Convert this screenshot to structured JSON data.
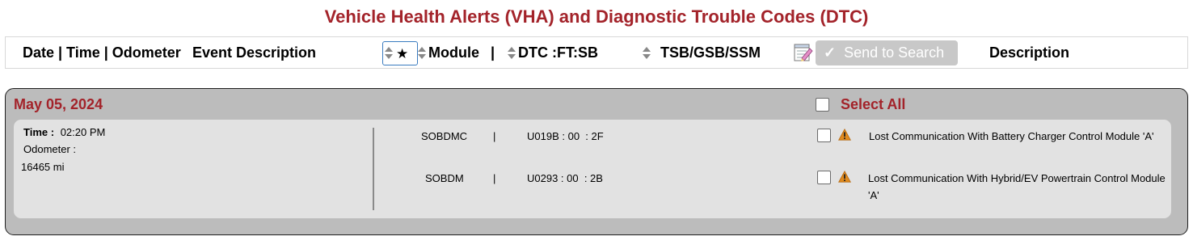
{
  "title": "Vehicle Health Alerts (VHA) and Diagnostic Trouble Codes (DTC)",
  "header": {
    "date_time_odometer": "Date | Time | Odometer",
    "event_description": "Event Description",
    "module": "Module",
    "module_sep": "|",
    "dtc": "DTC :FT:SB",
    "tsb": "TSB/GSB/SSM",
    "send_to_search": "Send to Search",
    "description": "Description"
  },
  "colors": {
    "title_red": "#a3232a",
    "panel_gray": "#bcbcbc",
    "card_gray": "#e2e2e2",
    "button_disabled": "#c8c8c8",
    "warning_orange": "#e08a1e"
  },
  "groups": [
    {
      "date": "May 05, 2024",
      "select_all_label": "Select All",
      "event": {
        "time_label": "Time :",
        "time_value": "02:20 PM",
        "odometer_label": "Odometer :",
        "odometer_value": "16465 mi",
        "rows": [
          {
            "module": "SOBDMC",
            "sep": "|",
            "dtc": "U019B : 00  : 2F",
            "description": "Lost Communication With Battery Charger Control Module 'A'",
            "icon": "warning-icon"
          },
          {
            "module": "SOBDM",
            "sep": "|",
            "dtc": "U0293 : 00  : 2B",
            "description": "Lost Communication With Hybrid/EV Powertrain Control Module 'A'",
            "icon": "warning-icon"
          }
        ]
      }
    }
  ]
}
